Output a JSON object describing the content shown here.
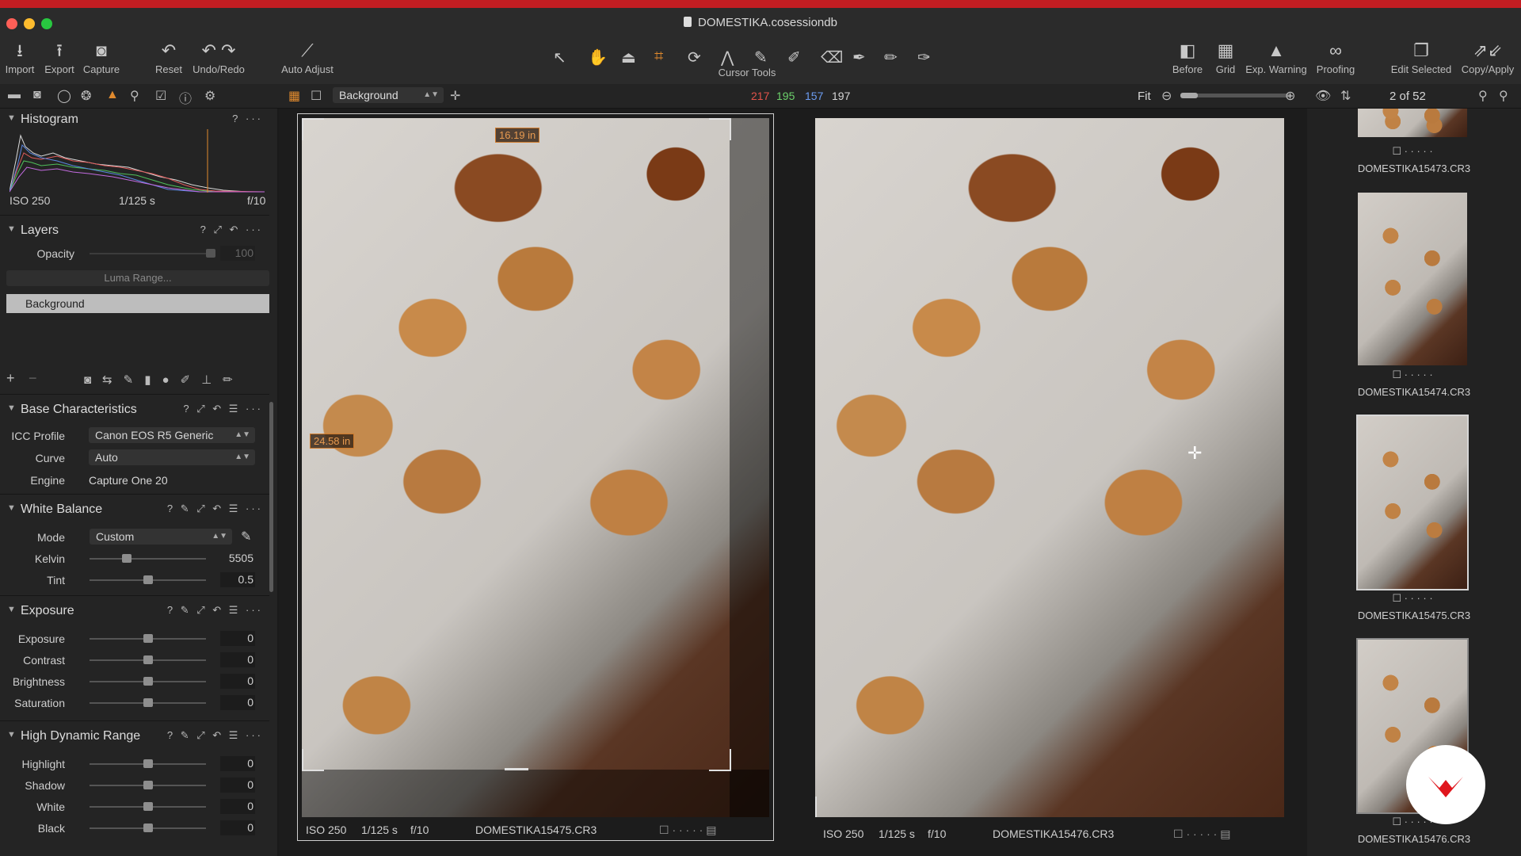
{
  "window": {
    "title": "DOMESTIKA.cosessiondb",
    "traffic_colors": [
      "#ff5f57",
      "#febc2e",
      "#28c840"
    ]
  },
  "toolbar": {
    "left": [
      {
        "label": "Import",
        "icon": "import-icon"
      },
      {
        "label": "Export",
        "icon": "export-icon"
      },
      {
        "label": "Capture",
        "icon": "camera-icon"
      },
      {
        "label": "Reset",
        "icon": "reset-icon"
      },
      {
        "label": "Undo/Redo",
        "icon": "undo-redo-icon"
      },
      {
        "label": "Auto Adjust",
        "icon": "magic-wand-icon"
      }
    ],
    "cursor_tools_label": "Cursor Tools",
    "right": [
      {
        "label": "Before",
        "icon": "before-icon"
      },
      {
        "label": "Grid",
        "icon": "grid-icon"
      },
      {
        "label": "Exp. Warning",
        "icon": "warning-icon"
      },
      {
        "label": "Proofing",
        "icon": "glasses-icon"
      },
      {
        "label": "Edit Selected",
        "icon": "edit-selected-icon"
      },
      {
        "label": "Copy/Apply",
        "icon": "copy-apply-icon"
      }
    ]
  },
  "subbar": {
    "layer_select": "Background",
    "rgb": {
      "r": "217",
      "g": "195",
      "b": "157",
      "l": "197"
    },
    "rgb_colors": {
      "r": "#e0534a",
      "g": "#6cd16b",
      "b": "#6c9cf0",
      "l": "#d6d6d6"
    },
    "zoom_label": "Fit",
    "counter": "2 of 52"
  },
  "histogram": {
    "title": "Histogram",
    "iso": "ISO 250",
    "shutter": "1/125 s",
    "aperture": "f/10"
  },
  "layers": {
    "title": "Layers",
    "opacity_label": "Opacity",
    "opacity_value": "100",
    "luma_range": "Luma Range...",
    "layer_name": "Background"
  },
  "base": {
    "title": "Base Characteristics",
    "icc_label": "ICC Profile",
    "icc_value": "Canon EOS R5 Generic",
    "curve_label": "Curve",
    "curve_value": "Auto",
    "engine_label": "Engine",
    "engine_value": "Capture One 20"
  },
  "white_balance": {
    "title": "White Balance",
    "mode_label": "Mode",
    "mode_value": "Custom",
    "kelvin_label": "Kelvin",
    "kelvin_value": "5505",
    "kelvin_pos": 0.3,
    "tint_label": "Tint",
    "tint_value": "0.5",
    "tint_pos": 0.5
  },
  "exposure": {
    "title": "Exposure",
    "rows": [
      {
        "label": "Exposure",
        "value": "0"
      },
      {
        "label": "Contrast",
        "value": "0"
      },
      {
        "label": "Brightness",
        "value": "0"
      },
      {
        "label": "Saturation",
        "value": "0"
      }
    ]
  },
  "hdr": {
    "title": "High Dynamic Range",
    "rows": [
      {
        "label": "Highlight",
        "value": "0"
      },
      {
        "label": "Shadow",
        "value": "0"
      },
      {
        "label": "White",
        "value": "0"
      },
      {
        "label": "Black",
        "value": "0"
      }
    ]
  },
  "viewer": {
    "left": {
      "iso": "ISO 250",
      "shutter": "1/125 s",
      "aperture": "f/10",
      "filename": "DOMESTIKA15475.CR3",
      "width_measure": "16.19 in",
      "height_measure": "24.58 in"
    },
    "right": {
      "iso": "ISO 250",
      "shutter": "1/125 s",
      "aperture": "f/10",
      "filename": "DOMESTIKA15476.CR3"
    }
  },
  "filmstrip": {
    "items": [
      {
        "name": "DOMESTIKA15473.CR3"
      },
      {
        "name": "DOMESTIKA15474.CR3"
      },
      {
        "name": "DOMESTIKA15475.CR3"
      },
      {
        "name": "DOMESTIKA15476.CR3"
      }
    ]
  },
  "colors": {
    "accent_orange": "#e08a2e",
    "brand_red": "#c21d22"
  }
}
